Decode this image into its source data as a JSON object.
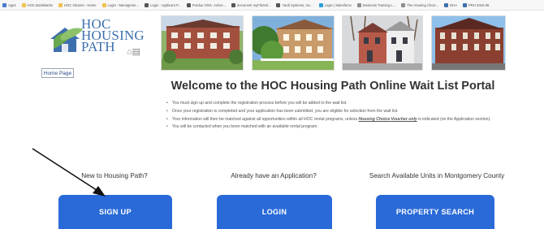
{
  "bookmarks": [
    {
      "label": "Apps",
      "color": "#4a7bd0"
    },
    {
      "label": "HOC BookMarks",
      "color": "#f2c14e"
    },
    {
      "label": "HOC Intranet - Home",
      "color": "#f2c14e"
    },
    {
      "label": "Login - Manageme...",
      "color": "#f2c14e"
    },
    {
      "label": "Login - Applicant P...",
      "color": "#555555"
    },
    {
      "label": "Purdue OWL: Active...",
      "color": "#555555"
    },
    {
      "label": "document myFileSel...",
      "color": "#555555"
    },
    {
      "label": "Yardi Systems, Inc...",
      "color": "#555555"
    },
    {
      "label": "Login | Salesforce",
      "color": "#2aa1d8"
    },
    {
      "label": "Business Training L...",
      "color": "#8e8e8e"
    },
    {
      "label": "The Housing Choic...",
      "color": "#8e8e8e"
    },
    {
      "label": "DHA",
      "color": "#3d6fae"
    },
    {
      "label": "PRH 2016-08",
      "color": "#3d6fae"
    }
  ],
  "logo": {
    "line1": "HOC",
    "line2": "HOUSING",
    "line3": "PATH"
  },
  "home_link": "Home Page",
  "welcome": "Welcome to the HOC Housing Path Online Wait List Portal",
  "bullets": [
    "You must sign up and complete the registration process before you will be added to the wait list.",
    "Once your registration is completed and your application has been submitted, you are eligible for selection from the wait list.",
    {
      "before": "Your information will then be matched against all opportunities within all HOC rental programs, unless ",
      "emphasis": "Housing Choice Voucher only",
      "after": " is indicated (on the Application section)."
    },
    "You will be contacted when you been matched with an available rental program."
  ],
  "columns": [
    {
      "heading": "New to Housing Path?",
      "button": "SIGN UP"
    },
    {
      "heading": "Already have an Application?",
      "button": "LOGIN"
    },
    {
      "heading": "Search Available Units in Montgomery County",
      "button": "PROPERTY SEARCH"
    }
  ],
  "colors": {
    "button": "#2a6ad8",
    "logo_blue": "#3d6fae",
    "logo_green": "#6aa84f"
  }
}
